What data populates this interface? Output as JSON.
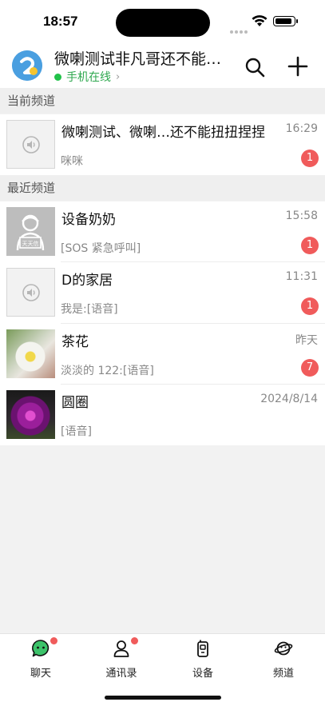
{
  "status": {
    "time": "18:57"
  },
  "header": {
    "title": "微喇测试非凡哥还不能…",
    "online": "手机在线",
    "chevron": "›"
  },
  "sections": {
    "current": "当前频道",
    "recent": "最近频道"
  },
  "current_channel": {
    "name": "微喇测试、微喇…还不能扭扭捏捏",
    "time": "16:29",
    "preview": "咪咪",
    "badge": "1"
  },
  "recent_channels": [
    {
      "name": "设备奶奶",
      "time": "15:58",
      "preview": "[SOS 紧急呼叫]",
      "badge": "1",
      "thumb_label": "天天信"
    },
    {
      "name": "D的家居",
      "time": "11:31",
      "preview": "我是:[语音]",
      "badge": "1"
    },
    {
      "name": "茶花",
      "time": "昨天",
      "preview": "淡淡的 122:[语音]",
      "badge": "7"
    },
    {
      "name": "圆圈",
      "time": "2024/8/14",
      "preview": "[语音]"
    }
  ],
  "tabs": [
    {
      "label": "聊天",
      "icon": "chat-icon",
      "dot": true
    },
    {
      "label": "通讯录",
      "icon": "contacts-icon",
      "dot": true
    },
    {
      "label": "设备",
      "icon": "device-icon",
      "dot": false
    },
    {
      "label": "频道",
      "icon": "channel-planet-icon",
      "dot": false
    }
  ],
  "colors": {
    "online": "#22c24a",
    "badge": "#f05b5b",
    "logo": "#4a9fe0"
  }
}
